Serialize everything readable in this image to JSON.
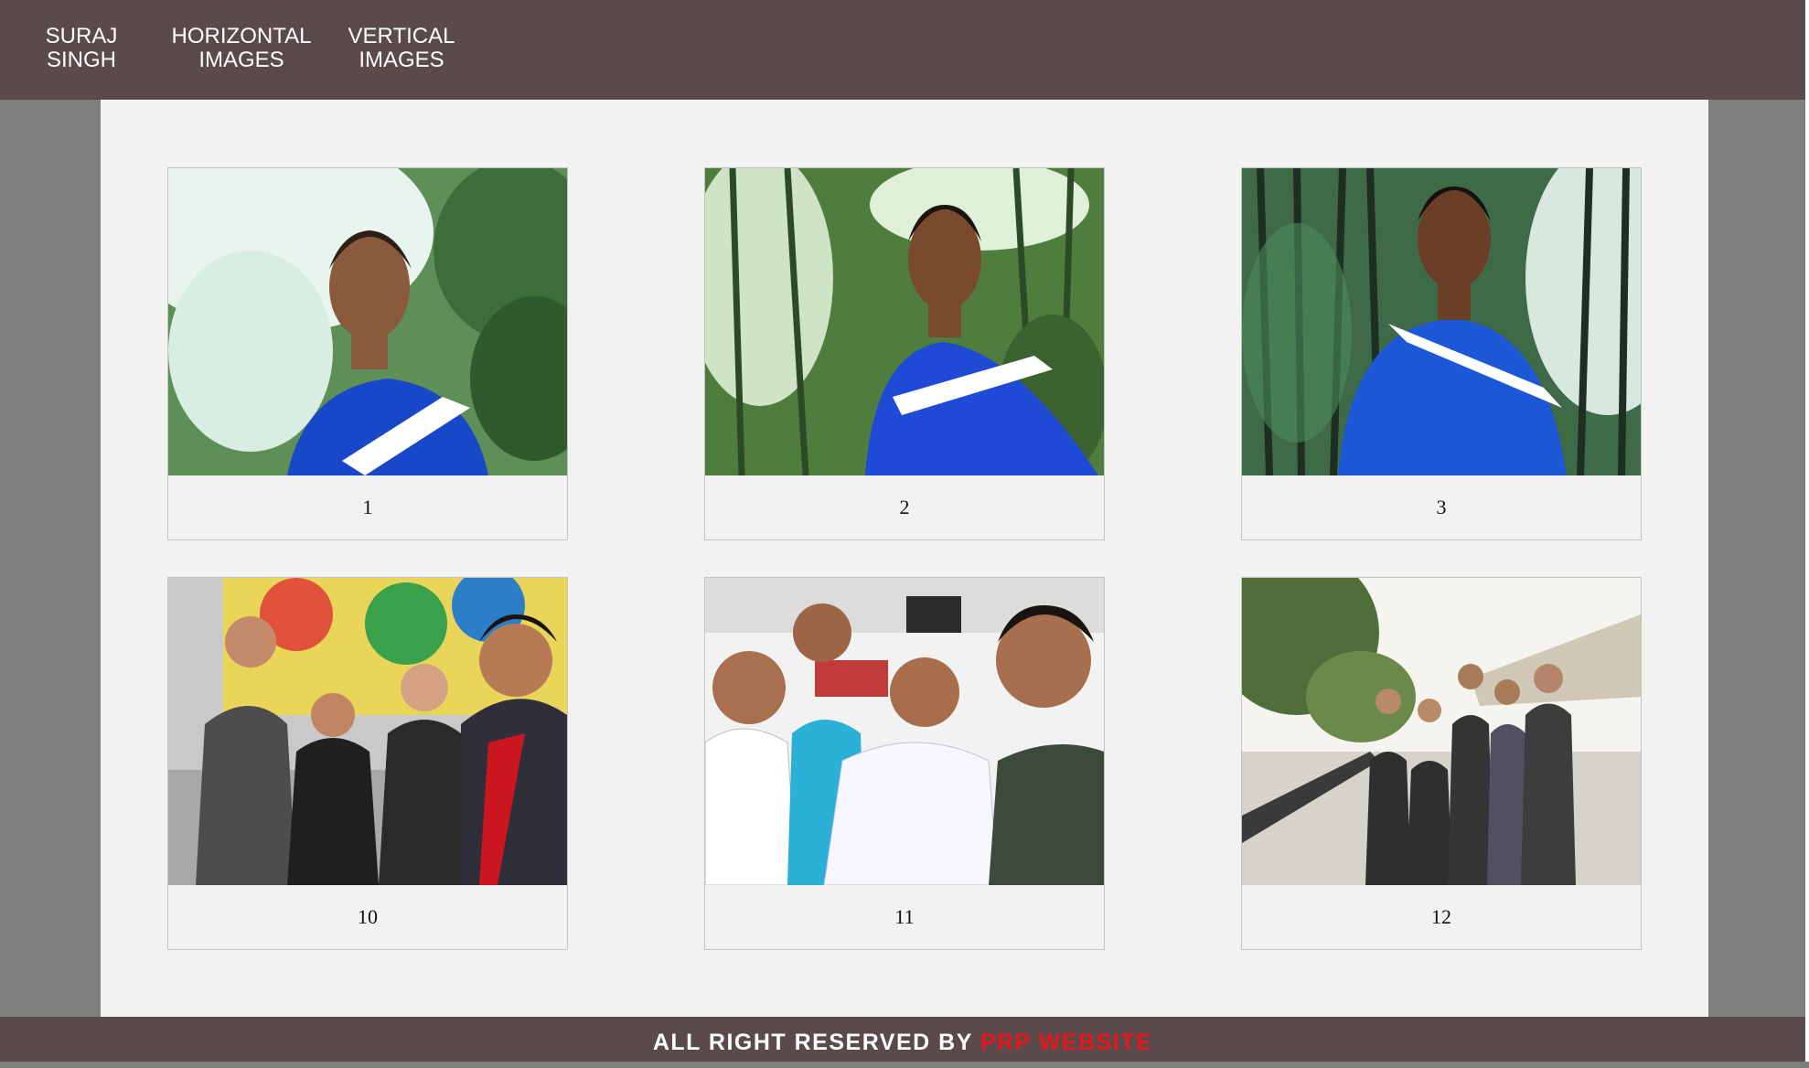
{
  "nav": {
    "items": [
      {
        "label": "SURAJ\nSINGH"
      },
      {
        "label": "HORIZONTAL\nIMAGES"
      },
      {
        "label": "VERTICAL\nIMAGES"
      }
    ]
  },
  "gallery": {
    "cards": [
      {
        "caption": "1"
      },
      {
        "caption": "2"
      },
      {
        "caption": "3"
      },
      {
        "caption": "10"
      },
      {
        "caption": "11"
      },
      {
        "caption": "12"
      }
    ]
  },
  "footer": {
    "text": "ALL RIGHT RESERVED BY ",
    "brand": "PRP WEBSITE"
  },
  "colors": {
    "header_bg": "#5a4a4b",
    "page_side_bg": "#7f7f7f",
    "content_bg": "#f2f2f2",
    "footer_brand": "#e8151b"
  }
}
